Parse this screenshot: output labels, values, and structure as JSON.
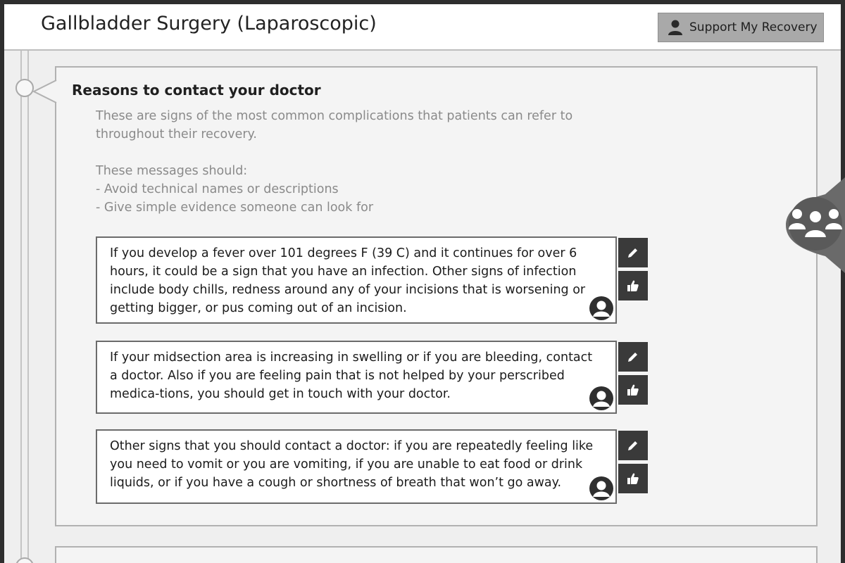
{
  "header": {
    "title": "Gallbladder Surgery (Laparoscopic)",
    "support_label": "Support My Recovery"
  },
  "panel": {
    "title": "Reasons to contact your doctor",
    "description": "These are signs of the most common complications that patients can refer to\nthroughout their recovery.\n\nThese messages should:\n- Avoid technical names or descriptions\n- Give simple evidence someone can look for",
    "messages": [
      {
        "text": "If  you develop a fever over 101 degrees F (39 C) and it continues for over 6 hours, it could be a sign that you have an infection.  Other signs of infection include body chills, redness around any of your incisions that is worsening or getting bigger, or pus coming out of an incision."
      },
      {
        "text": "If your midsection area is increasing in swelling or if you are bleeding, contact a doctor.  Also if you are feeling pain that is not helped by your perscribed medica-tions, you should get in touch with your doctor."
      },
      {
        "text": "Other signs that you should contact a doctor: if you are repeatedly feeling like you need to vomit or you are vomiting, if you are unable to eat food or drink liquids, or if you have a cough or shortness of breath that won’t go away."
      }
    ]
  },
  "icons": {
    "support": "person-icon",
    "edit": "pencil-icon",
    "like": "thumbs-up-icon",
    "author": "user-avatar-icon",
    "community": "group-icon"
  },
  "colors": {
    "button_bg": "#a9a9a9",
    "action_bg": "#3a3a3a",
    "panel_border": "#b1b1b1",
    "message_border": "#6b6b6b"
  }
}
